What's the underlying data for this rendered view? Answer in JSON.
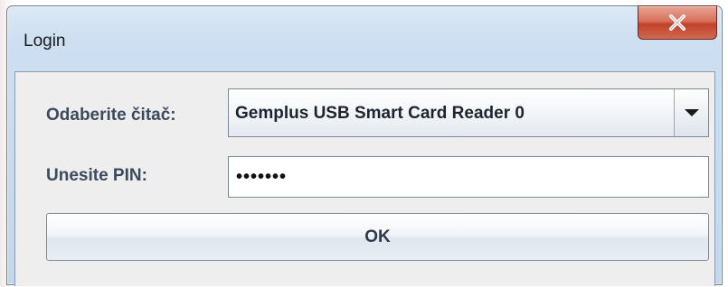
{
  "window": {
    "title": "Login",
    "close_icon": "close-x-icon"
  },
  "form": {
    "reader_label": "Odaberite čitač:",
    "reader_selected": "Gemplus USB Smart Card Reader 0",
    "reader_dropdown_icon": "chevron-down-icon",
    "pin_label": "Unesite PIN:",
    "pin_value": "•••••••",
    "ok_label": "OK"
  },
  "colors": {
    "close_button": "#c2412a",
    "label_text": "#3c4a5c"
  }
}
